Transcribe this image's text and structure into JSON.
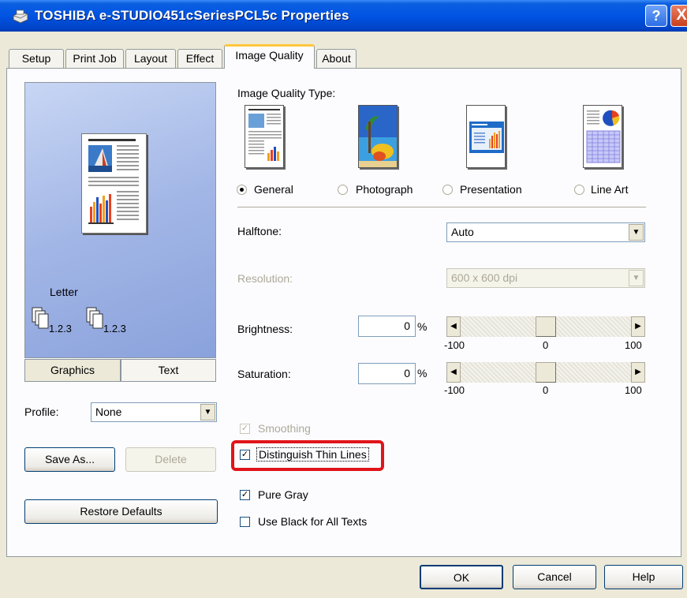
{
  "window": {
    "title": "TOSHIBA e-STUDIO451cSeriesPCL5c Properties",
    "help_label": "?",
    "close_label": "X"
  },
  "tabs": [
    {
      "label": "Setup",
      "active": false
    },
    {
      "label": "Print Job",
      "active": false
    },
    {
      "label": "Layout",
      "active": false
    },
    {
      "label": "Effect",
      "active": false
    },
    {
      "label": "Image Quality",
      "active": true
    },
    {
      "label": "About",
      "active": false
    }
  ],
  "preview": {
    "paper_label": "Letter",
    "collate_1": "1.2.3",
    "collate_2": "1.2.3"
  },
  "mode_toggle": {
    "graphics": "Graphics",
    "text": "Text",
    "selected": "Graphics"
  },
  "profile": {
    "label": "Profile:",
    "value": "None"
  },
  "buttons": {
    "save_as": "Save As...",
    "delete": "Delete",
    "restore_defaults": "Restore Defaults",
    "ok": "OK",
    "cancel": "Cancel",
    "help": "Help"
  },
  "image_quality": {
    "type_label": "Image Quality Type:",
    "types": [
      {
        "label": "General",
        "selected": true
      },
      {
        "label": "Photograph",
        "selected": false
      },
      {
        "label": "Presentation",
        "selected": false
      },
      {
        "label": "Line Art",
        "selected": false
      }
    ]
  },
  "halftone": {
    "label": "Halftone:",
    "value": "Auto"
  },
  "resolution": {
    "label": "Resolution:",
    "value": "600 x 600 dpi",
    "enabled": false
  },
  "brightness": {
    "label": "Brightness:",
    "value": "0",
    "unit": "%",
    "min": "-100",
    "mid": "0",
    "max": "100",
    "level": 0
  },
  "saturation": {
    "label": "Saturation:",
    "value": "0",
    "unit": "%",
    "min": "-100",
    "mid": "0",
    "max": "100",
    "level": 0
  },
  "checkboxes": {
    "smoothing": {
      "label": "Smoothing",
      "checked": true,
      "enabled": false
    },
    "distinguish_thin_lines": {
      "label": "Distinguish Thin Lines",
      "checked": true,
      "enabled": true
    },
    "pure_gray": {
      "label": "Pure Gray",
      "checked": true,
      "enabled": true
    },
    "use_black": {
      "label": "Use Black for All Texts",
      "checked": false,
      "enabled": true
    }
  },
  "colors": {
    "highlight": "#E0141A",
    "titlebar": "#0054E3",
    "active_tab_accent": "#FFC83C"
  }
}
